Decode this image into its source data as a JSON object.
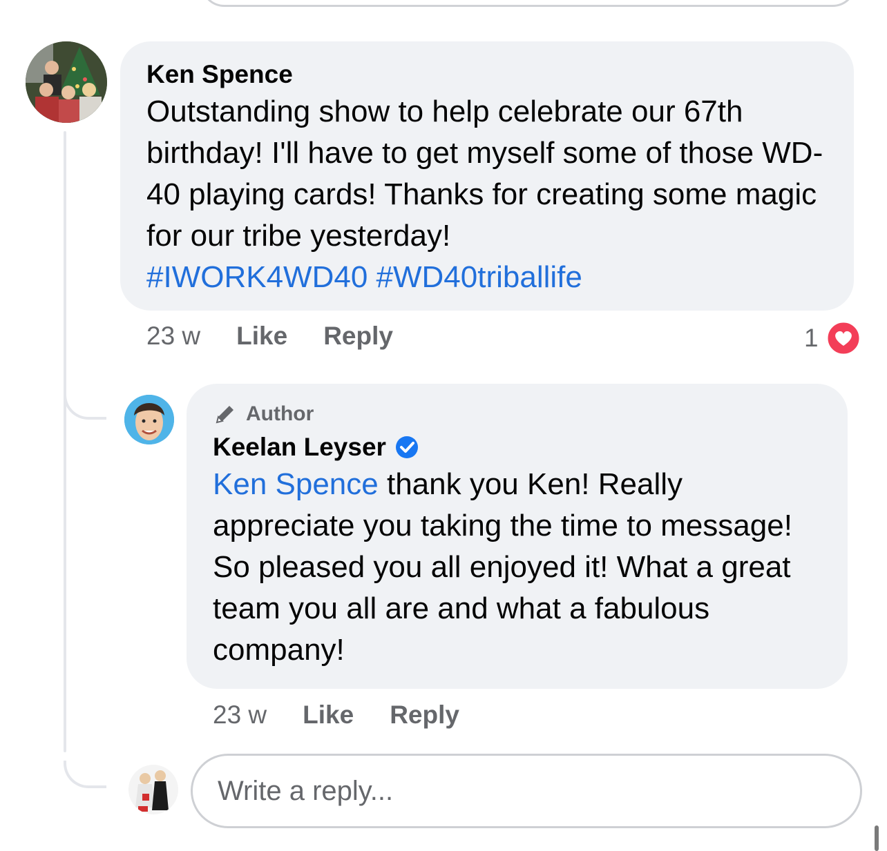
{
  "comment": {
    "author": "Ken Spence",
    "text": "Outstanding show to help celebrate our 67th birthday! I'll have to get myself some of those WD-40 playing cards! Thanks for creating some magic for our tribe yesterday!",
    "hashtag_1": "#IWORK4WD40",
    "hashtag_2": "#WD40triballife",
    "time": "23 w",
    "like_label": "Like",
    "reply_label": "Reply",
    "reaction_count": "1"
  },
  "reply": {
    "badge": "Author",
    "author": "Keelan Leyser",
    "mention": "Ken Spence",
    "text": " thank you Ken! Really appreciate you taking the time to message! So pleased you all enjoyed it! What a great team you all are and what a fabulous company!",
    "time": "23 w",
    "like_label": "Like",
    "reply_label": "Reply"
  },
  "composer": {
    "placeholder": "Write a reply..."
  },
  "colors": {
    "bubble": "#f0f2f5",
    "link": "#216fdb",
    "verified": "#1877f2",
    "heart": "#f33e58",
    "muted": "#65676b"
  },
  "icons": {
    "verified": "verified-badge-icon",
    "author": "pencil-icon",
    "reaction": "heart-icon"
  }
}
